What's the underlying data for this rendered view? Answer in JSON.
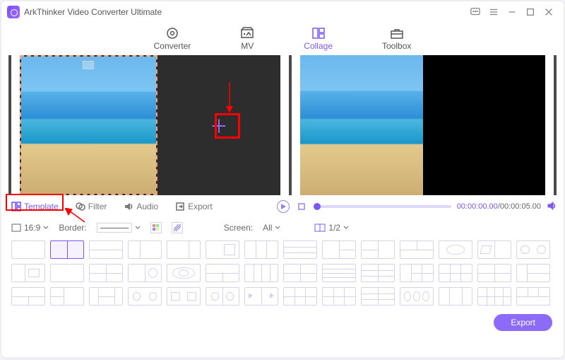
{
  "app": {
    "title": "ArkThinker Video Converter Ultimate"
  },
  "tabs": {
    "converter": "Converter",
    "mv": "MV",
    "collage": "Collage",
    "toolbox": "Toolbox"
  },
  "midtabs": {
    "template": "Template",
    "filter": "Filter",
    "audio": "Audio",
    "export": "Export"
  },
  "playback": {
    "current": "00:00:00.00",
    "total": "00:00:05.00"
  },
  "options": {
    "ratio": "16:9",
    "border_label": "Border:",
    "screen_label": "Screen:",
    "screen_value": "All",
    "split_value": "1/2"
  },
  "footer": {
    "export": "Export"
  }
}
